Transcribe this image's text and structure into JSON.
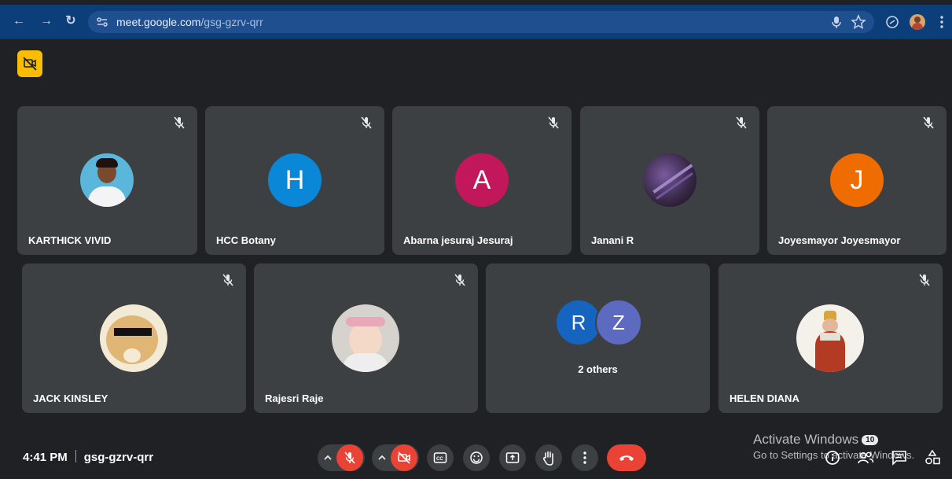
{
  "browser": {
    "url_host": "meet.google.com",
    "url_path": "/gsg-gzrv-qrr"
  },
  "tiles_row1": [
    {
      "name": "KARTHICK VIVID",
      "avatar_type": "photo",
      "avatar_color": "#59b4d9"
    },
    {
      "name": "HCC Botany",
      "avatar_type": "letter",
      "initial": "H",
      "avatar_color": "#0b87d8"
    },
    {
      "name": "Abarna jesuraj Jesuraj",
      "avatar_type": "letter",
      "initial": "A",
      "avatar_color": "#c2185b"
    },
    {
      "name": "Janani R",
      "avatar_type": "photo",
      "avatar_color": "#3b2a4a"
    },
    {
      "name": "Joyesmayor Joyesmayor",
      "avatar_type": "letter",
      "initial": "J",
      "avatar_color": "#ef6c00"
    }
  ],
  "tiles_row2": [
    {
      "name": "JACK KINSLEY",
      "avatar_type": "photo",
      "avatar_color": "#e5c48a"
    },
    {
      "name": "Rajesri Raje",
      "avatar_type": "photo",
      "avatar_color": "#d9d4cf"
    },
    {
      "name": "2 others",
      "avatar_type": "group",
      "initials": [
        "R",
        "Z"
      ],
      "colors": [
        "#1565c0",
        "#5c6bc0"
      ]
    },
    {
      "name": "HELEN DIANA",
      "avatar_type": "photo",
      "avatar_color": "#f2efe9"
    }
  ],
  "footer": {
    "time": "4:41 PM",
    "meeting_code": "gsg-gzrv-qrr"
  },
  "activation": {
    "title": "Activate Windows",
    "badge": "10",
    "subtitle": "Go to Settings to activate Windows."
  },
  "colors": {
    "background": "#202124",
    "tile": "#3c4043",
    "danger": "#ea4335",
    "browser_bar": "#0c3f79",
    "badge_yellow": "#fbbc04"
  }
}
